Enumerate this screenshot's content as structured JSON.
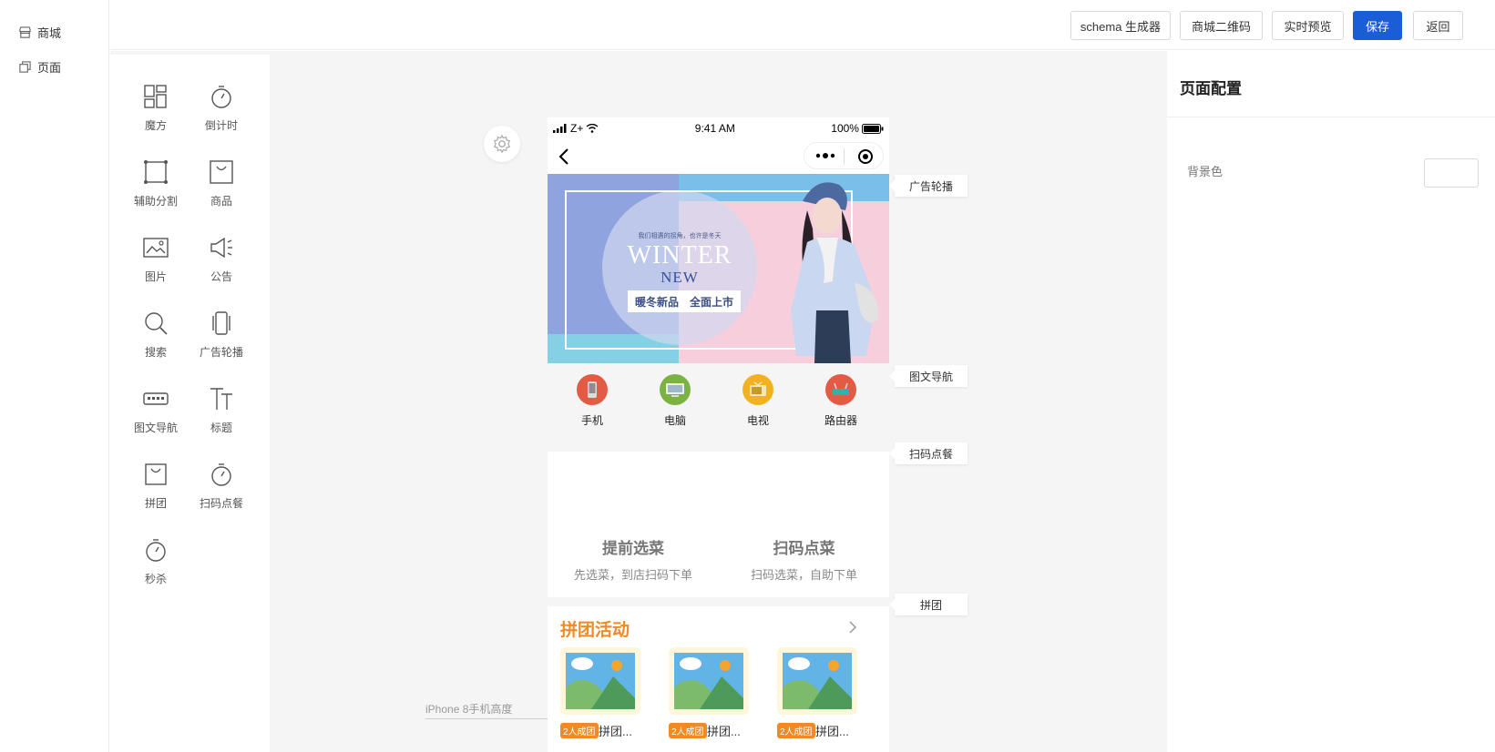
{
  "leftnav": {
    "items": [
      {
        "label": "商城",
        "icon": "store-icon"
      },
      {
        "label": "页面",
        "icon": "page-icon"
      }
    ]
  },
  "topbar": {
    "schema_label": "schema 生成器",
    "qrcode_label": "商城二维码",
    "preview_label": "实时预览",
    "save_label": "保存",
    "back_label": "返回"
  },
  "palette": {
    "items": [
      {
        "label": "魔方",
        "icon": "grid-layout-icon"
      },
      {
        "label": "倒计时",
        "icon": "stopwatch-icon"
      },
      {
        "label": "辅助分割",
        "icon": "divider-box-icon"
      },
      {
        "label": "商品",
        "icon": "shopping-bag-icon"
      },
      {
        "label": "图片",
        "icon": "image-icon"
      },
      {
        "label": "公告",
        "icon": "megaphone-icon"
      },
      {
        "label": "搜索",
        "icon": "search-icon"
      },
      {
        "label": "广告轮播",
        "icon": "carousel-icon"
      },
      {
        "label": "图文导航",
        "icon": "keyboard-nav-icon"
      },
      {
        "label": "标题",
        "icon": "title-text-icon"
      },
      {
        "label": "拼团",
        "icon": "shopping-bag-icon"
      },
      {
        "label": "扫码点餐",
        "icon": "stopwatch-icon"
      },
      {
        "label": "秒杀",
        "icon": "stopwatch-icon"
      }
    ]
  },
  "phone": {
    "status": {
      "carrier": "Z+",
      "time": "9:41 AM",
      "battery": "100%"
    },
    "banner": {
      "tagline": "我们相遇的拐角，也许是冬天",
      "title1": "WINTER",
      "title2": "NEW",
      "sub1": "暖冬新品",
      "sub2": "全面上市"
    },
    "iconnav": [
      {
        "label": "手机",
        "color": "#e35a45"
      },
      {
        "label": "电脑",
        "color": "#7ab342"
      },
      {
        "label": "电视",
        "color": "#f2b21f"
      },
      {
        "label": "路由器",
        "color": "#e35a45"
      }
    ],
    "scan_order": [
      {
        "title": "提前选菜",
        "sub": "先选菜，到店扫码下单"
      },
      {
        "title": "扫码点菜",
        "sub": "扫码选菜，自助下单"
      }
    ],
    "group": {
      "title": "拼团活动",
      "items": [
        {
          "badge": "2人成团",
          "name": "拼团..."
        },
        {
          "badge": "2人成团",
          "name": "拼团..."
        },
        {
          "badge": "2人成团",
          "name": "拼团..."
        }
      ]
    }
  },
  "floating_labels": [
    "广告轮播",
    "图文导航",
    "扫码点餐",
    "拼团"
  ],
  "iphone_height_label": "iPhone 8手机高度",
  "rightpanel": {
    "title": "页面配置",
    "bg_label": "背景色"
  },
  "colors": {
    "primary": "#1a5dd6",
    "group_title": "#f08a24",
    "canvas_bg": "#f5f5f5"
  }
}
